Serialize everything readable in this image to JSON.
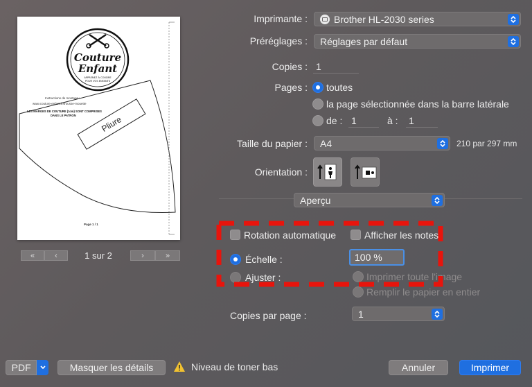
{
  "preview": {
    "logo_line1": "Couture",
    "logo_line2": "Enfant",
    "logo_tagline": "APPRENEZ À COUDRE",
    "logo_tagline2": "POUR VOS ENFANTS",
    "instructions_title": "Instructions de montage :",
    "instructions_url": "www.couture-enfant.fr/trousse-mouette",
    "margins_note_line1": "LES MARGES DE COUTURE (1cm) SONT COMPRISES",
    "margins_note_line2": "DANS LE PATRON",
    "pliure": "Pliure",
    "page_label": "Page 1 / 1",
    "pager_text": "1 sur 2",
    "first_label": "«",
    "prev_label": "‹",
    "next_label": "›",
    "last_label": "»"
  },
  "printer": {
    "label": "Imprimante :",
    "value": "Brother HL-2030 series"
  },
  "presets": {
    "label": "Préréglages :",
    "value": "Réglages par défaut"
  },
  "copies": {
    "label": "Copies :",
    "value": "1"
  },
  "pages": {
    "label": "Pages :",
    "option_all": "toutes",
    "option_selected": "la page sélectionnée dans la barre latérale",
    "option_from": "de :",
    "from_value": "1",
    "to_label": "à :",
    "to_value": "1"
  },
  "paper_size": {
    "label": "Taille du papier :",
    "value": "A4",
    "dimensions": "210 par 297 mm"
  },
  "orientation": {
    "label": "Orientation :"
  },
  "section_popup": {
    "value": "Aperçu"
  },
  "options": {
    "auto_rotate": "Rotation automatique",
    "show_notes": "Afficher les notes",
    "scale_label": "Échelle :",
    "scale_value": "100 %",
    "fit_label": "Ajuster :",
    "fit_print_whole": "Imprimer toute l'image",
    "fit_fill_paper": "Remplir le papier en entier"
  },
  "copies_per_page": {
    "label": "Copies par page :",
    "value": "1"
  },
  "footer": {
    "pdf_label": "PDF",
    "hide_details": "Masquer les détails",
    "toner_warning": "Niveau de toner bas",
    "cancel": "Annuler",
    "print": "Imprimer"
  },
  "colors": {
    "accent": "#1f6fe0",
    "highlight_dash": "#e8140c",
    "warning": "#f2c230"
  },
  "icons": {
    "arrows": "chevron-updown-icon",
    "warning": "warning-triangle-icon",
    "printer_status": "printer-status-icon",
    "portrait": "portrait-orientation-icon",
    "landscape": "landscape-orientation-icon"
  }
}
